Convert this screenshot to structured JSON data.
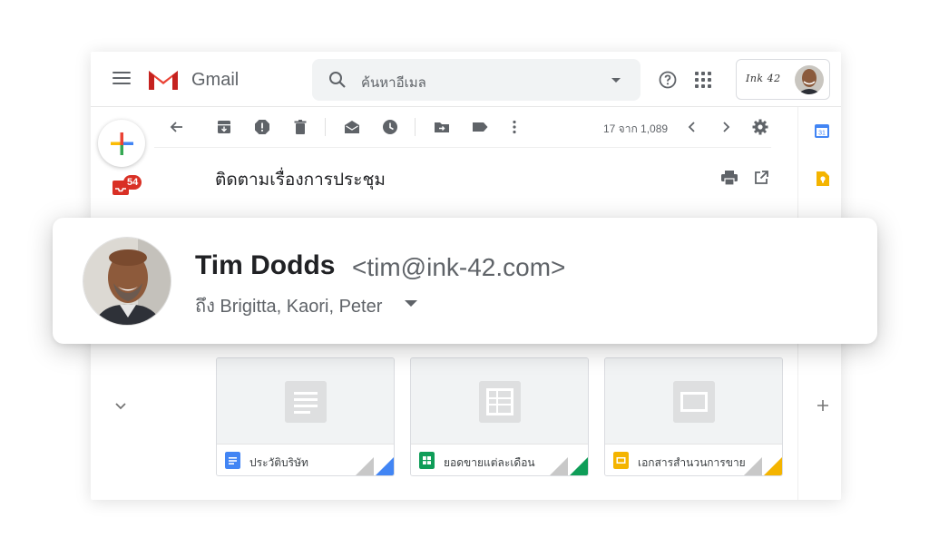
{
  "header": {
    "app_name": "Gmail",
    "search_placeholder": "ค้นหาอีเมล",
    "account_logo_text": "Ink 42"
  },
  "left_rail": {
    "inbox_badge": "54"
  },
  "toolbar": {
    "pager": "17 จาก 1,089"
  },
  "message": {
    "subject": "ติดตามเรื่องการประชุม"
  },
  "sender_card": {
    "name": "Tim Dodds",
    "email": "<tim@ink-42.com>",
    "recipients": "ถึง Brigitta, Kaori, Peter"
  },
  "attachments": [
    {
      "name": "ประวัติบริษัท",
      "type_icon": "docs-icon",
      "color": "#4285f4"
    },
    {
      "name": "ยอดขายแต่ละเดือน",
      "type_icon": "sheets-icon",
      "color": "#0f9d58"
    },
    {
      "name": "เอกสารสำนวนการขาย",
      "type_icon": "slides-icon",
      "color": "#f4b400"
    }
  ],
  "colors": {
    "accent_red": "#d93025",
    "gmail_red": "#ea4335",
    "calendar_blue": "#4285f4",
    "keep_yellow": "#f4b400"
  }
}
